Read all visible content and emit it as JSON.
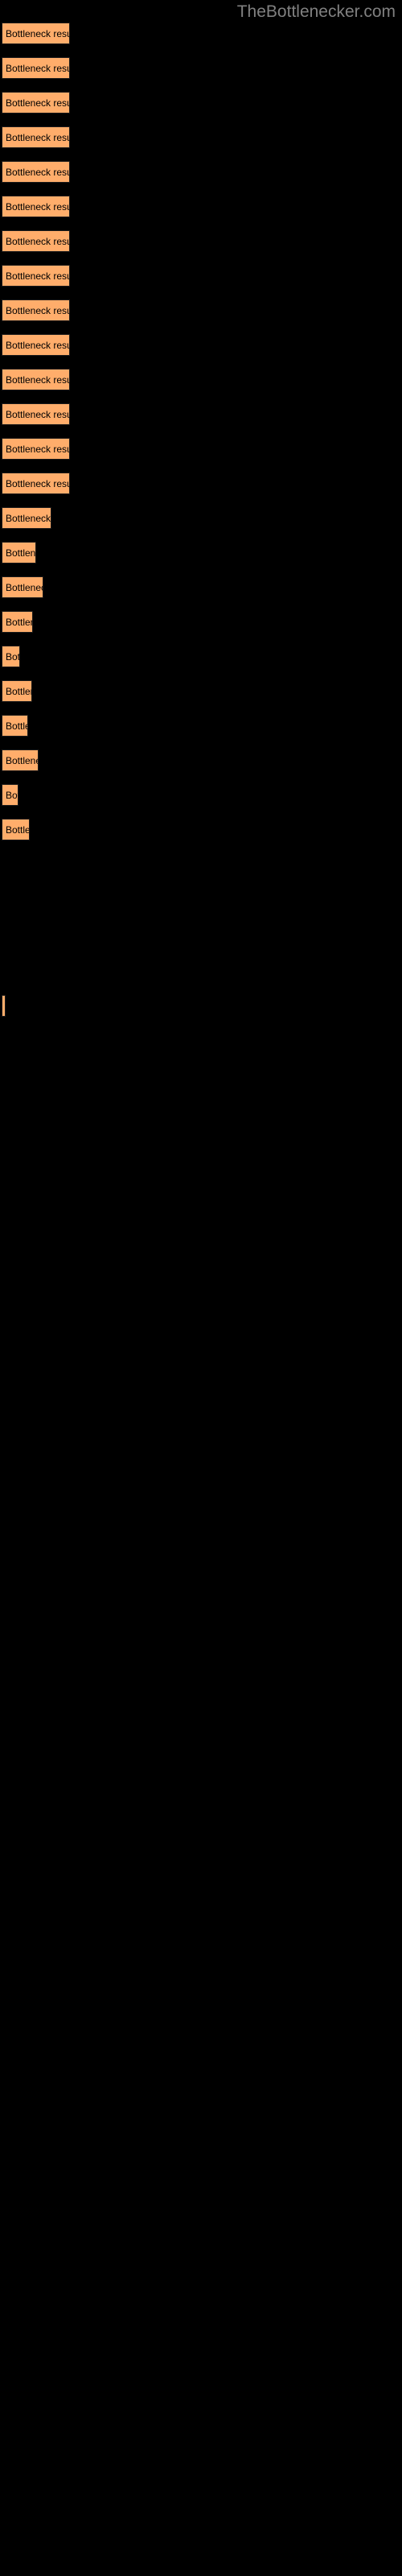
{
  "site": {
    "title": "TheBottlenecker.com",
    "title_color": "#808080"
  },
  "theme": {
    "background": "#000000",
    "bar_fill": "#ffad6b",
    "bar_border": "#1a1a1a",
    "label_color": "#000000"
  },
  "chart_data": {
    "type": "bar",
    "orientation": "horizontal",
    "title": "TheBottlenecker.com",
    "xlabel": "",
    "ylabel": "",
    "grid": false,
    "legend": false,
    "axis_visible": false,
    "bar_label_text": "Bottleneck result",
    "categories": [
      "Bottleneck result",
      "Bottleneck result",
      "Bottleneck result",
      "Bottleneck result",
      "Bottleneck result",
      "Bottleneck result",
      "Bottleneck result",
      "Bottleneck result",
      "Bottleneck result",
      "Bottleneck result",
      "Bottleneck result",
      "Bottleneck result",
      "Bottleneck result",
      "Bottleneck result",
      "Bottleneck result",
      "Bottleneck result",
      "Bottleneck result",
      "Bottleneck result",
      "Bottleneck result",
      "Bottleneck result",
      "Bottleneck result",
      "Bottleneck result",
      "Bottleneck result",
      "Bottleneck result",
      "Bottleneck result",
      "Bottleneck result"
    ],
    "values": [
      85,
      85,
      85,
      85,
      85,
      85,
      85,
      85,
      85,
      85,
      85,
      85,
      85,
      62,
      43,
      52,
      39,
      23,
      38,
      33,
      46,
      21,
      35,
      4
    ],
    "xlim": [
      0,
      500
    ],
    "bars": [
      {
        "index": 0,
        "y": 28,
        "width": 85,
        "label": "Bottleneck result"
      },
      {
        "index": 1,
        "y": 71,
        "width": 85,
        "label": "Bottleneck result"
      },
      {
        "index": 2,
        "y": 114,
        "width": 85,
        "label": "Bottleneck result"
      },
      {
        "index": 3,
        "y": 157,
        "width": 85,
        "label": "Bottleneck result"
      },
      {
        "index": 4,
        "y": 200,
        "width": 85,
        "label": "Bottleneck result"
      },
      {
        "index": 5,
        "y": 243,
        "width": 85,
        "label": "Bottleneck result"
      },
      {
        "index": 6,
        "y": 286,
        "width": 85,
        "label": "Bottleneck result"
      },
      {
        "index": 7,
        "y": 329,
        "width": 85,
        "label": "Bottleneck result"
      },
      {
        "index": 8,
        "y": 372,
        "width": 85,
        "label": "Bottleneck result"
      },
      {
        "index": 9,
        "y": 415,
        "width": 85,
        "label": "Bottleneck result"
      },
      {
        "index": 10,
        "y": 458,
        "width": 85,
        "label": "Bottleneck result"
      },
      {
        "index": 11,
        "y": 501,
        "width": 85,
        "label": "Bottleneck result"
      },
      {
        "index": 12,
        "y": 544,
        "width": 85,
        "label": "Bottleneck result"
      },
      {
        "index": 13,
        "y": 587,
        "width": 85,
        "label": "Bottleneck result"
      },
      {
        "index": 14,
        "y": 630,
        "width": 62,
        "label": "Bottleneck result"
      },
      {
        "index": 15,
        "y": 673,
        "width": 43,
        "label": "Bottleneck result"
      },
      {
        "index": 16,
        "y": 716,
        "width": 52,
        "label": "Bottleneck result"
      },
      {
        "index": 17,
        "y": 759,
        "width": 39,
        "label": "Bottleneck result"
      },
      {
        "index": 18,
        "y": 802,
        "width": 23,
        "label": "Bottleneck result"
      },
      {
        "index": 19,
        "y": 845,
        "width": 38,
        "label": "Bottleneck result"
      },
      {
        "index": 20,
        "y": 888,
        "width": 33,
        "label": "Bottleneck result"
      },
      {
        "index": 21,
        "y": 931,
        "width": 46,
        "label": "Bottleneck result"
      },
      {
        "index": 22,
        "y": 974,
        "width": 21,
        "label": "Bottleneck result"
      },
      {
        "index": 23,
        "y": 1017,
        "width": 35,
        "label": "Bottleneck result"
      },
      {
        "index": 24,
        "y": 1236,
        "width": 5,
        "label": ""
      }
    ]
  }
}
